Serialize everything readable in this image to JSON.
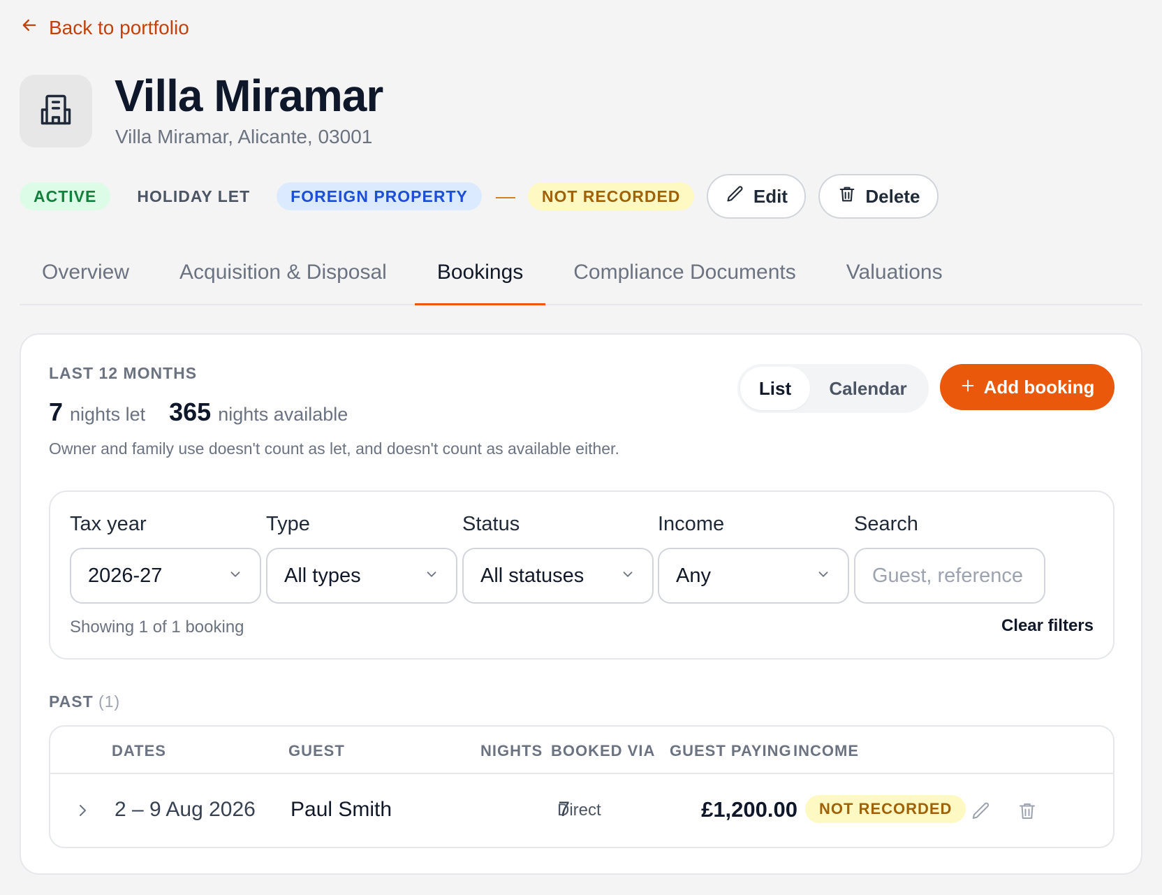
{
  "nav": {
    "back_label": "Back to portfolio"
  },
  "property": {
    "name": "Villa Miramar",
    "address": "Villa Miramar, Alicante, 03001",
    "icon": "building-icon"
  },
  "badges": {
    "status": "ACTIVE",
    "let_type": "HOLIDAY LET",
    "location": "FOREIGN PROPERTY",
    "separator": "—",
    "record": "NOT RECORDED"
  },
  "actions": {
    "edit_label": "Edit",
    "delete_label": "Delete"
  },
  "tabs": [
    {
      "label": "Overview",
      "active": false
    },
    {
      "label": "Acquisition & Disposal",
      "active": false
    },
    {
      "label": "Bookings",
      "active": true
    },
    {
      "label": "Compliance Documents",
      "active": false
    },
    {
      "label": "Valuations",
      "active": false
    }
  ],
  "summary": {
    "period": "LAST 12 MONTHS",
    "nights_let": "7",
    "nights_let_label": "nights let",
    "nights_available": "365",
    "nights_available_label": "nights available",
    "note": "Owner and family use doesn't count as let, and doesn't count as available either."
  },
  "view_toggle": {
    "list": "List",
    "calendar": "Calendar",
    "selected": "List"
  },
  "add_booking_label": "Add booking",
  "filters": {
    "tax_year": {
      "label": "Tax year",
      "value": "2026-27"
    },
    "type": {
      "label": "Type",
      "value": "All types"
    },
    "status": {
      "label": "Status",
      "value": "All statuses"
    },
    "income": {
      "label": "Income",
      "value": "Any"
    },
    "search": {
      "label": "Search",
      "placeholder": "Guest, reference",
      "value": ""
    },
    "showing": "Showing 1 of 1 booking",
    "clear_label": "Clear filters"
  },
  "past": {
    "heading": "PAST",
    "count": "(1)",
    "columns": {
      "dates": "DATES",
      "guest": "GUEST",
      "nights": "NIGHTS",
      "booked_via": "BOOKED VIA",
      "guest_paying": "GUEST PAYING",
      "income": "INCOME"
    },
    "rows": [
      {
        "dates": "2 – 9 Aug 2026",
        "guest": "Paul Smith",
        "nights": "7",
        "booked_via": "Direct",
        "guest_paying": "£1,200.00",
        "income": "NOT RECORDED"
      }
    ]
  },
  "colors": {
    "accent": "#ea580c",
    "back_link": "#c2410c",
    "active_bg": "#dcfce7",
    "foreign_bg": "#dbeafe",
    "not_recorded_bg": "#fef9c3"
  }
}
